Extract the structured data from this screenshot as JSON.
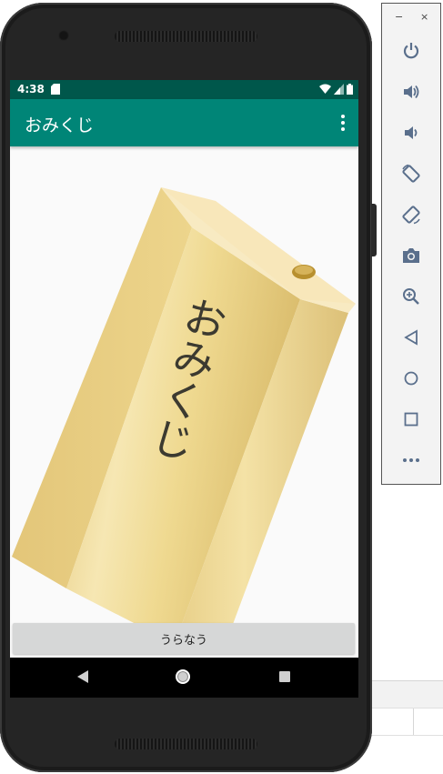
{
  "statusbar": {
    "time": "4:38"
  },
  "appbar": {
    "title": "おみくじ"
  },
  "omikuji": {
    "label": "おみくじ"
  },
  "button": {
    "label": "うらなう"
  },
  "emulator": {
    "minimize": "−",
    "close": "×"
  },
  "colors": {
    "primary": "#008577",
    "primary_dark": "#00574b",
    "box_face": "#efd990",
    "background": "#fafafa"
  }
}
